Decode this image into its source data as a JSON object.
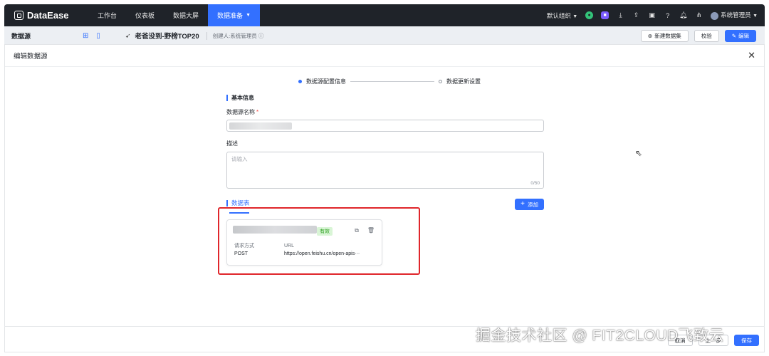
{
  "app": {
    "brand": "DataEase"
  },
  "nav": {
    "items": [
      {
        "label": "工作台",
        "active": false
      },
      {
        "label": "仪表板",
        "active": false
      },
      {
        "label": "数据大屏",
        "active": false
      },
      {
        "label": "数据准备",
        "active": true
      }
    ],
    "org": "默认组织",
    "user": "系统管理员",
    "accent": "#3370ff"
  },
  "subbar": {
    "title": "数据源",
    "datasource_name": "老爸没到-野榜TOP20",
    "creator": "创建人:系统管理员",
    "actions": {
      "new_dataset": "新建数据集",
      "validate": "校验",
      "edit": "编辑"
    }
  },
  "drawer": {
    "title": "编辑数据源",
    "steps": [
      "数据源配置信息",
      "数据更新设置"
    ],
    "section_basic": "基本信息",
    "name_label": "数据源名称",
    "name_required": "*",
    "desc_label": "描述",
    "desc_placeholder": "请输入",
    "desc_counter": "0/50",
    "tab_tables": "数据表",
    "add_button": "添加",
    "card": {
      "status": "有效",
      "method_key": "请求方式",
      "method_value": "POST",
      "url_key": "URL",
      "url_value": "https://open.feishu.cn/open-apis···"
    },
    "footer": {
      "cancel": "取消",
      "prev": "上一步",
      "save": "保存"
    }
  },
  "watermark": "掘金技术社区 @ FIT2CLOUD飞致云"
}
